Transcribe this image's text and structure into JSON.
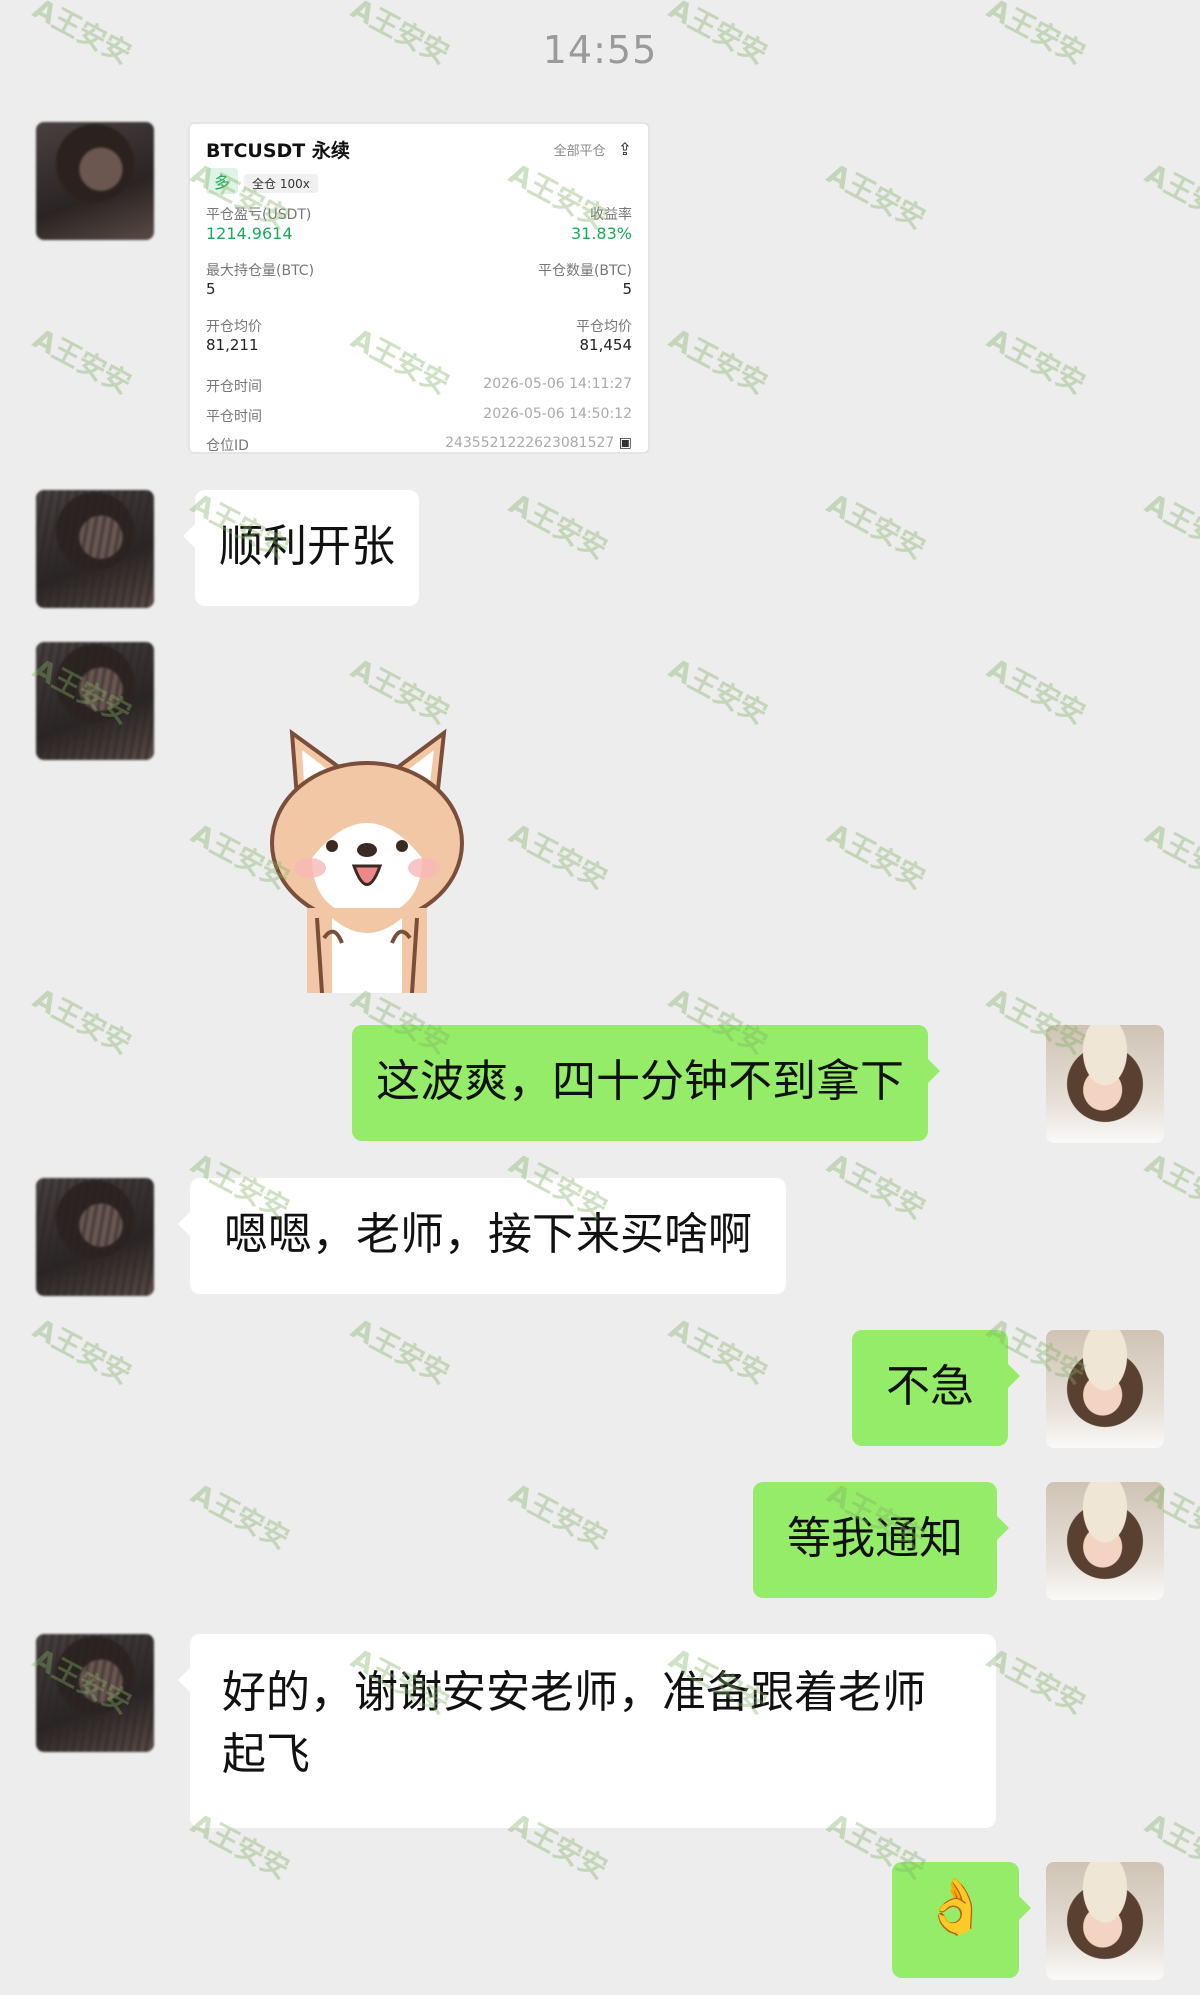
{
  "status": {
    "time": "14:55"
  },
  "trade_card": {
    "title": "BTCUSDT 永续",
    "tag_side": "多",
    "tag_margin": "全仓 100x",
    "action_label": "全部平仓",
    "pnl_label": "平仓盈亏(USDT)",
    "pnl_value": "1214.9614",
    "roi_label": "收益率",
    "roi_value": "31.83%",
    "max_pos_label": "最大持仓量(BTC)",
    "max_pos_value": "5",
    "close_qty_label": "平仓数量(BTC)",
    "close_qty_value": "5",
    "open_avg_label": "开仓均价",
    "open_avg_value": "81,211",
    "close_avg_label": "平仓均价",
    "close_avg_value": "81,454",
    "open_time_label": "开仓时间",
    "open_time_value": "2026-05-06 14:11:27",
    "close_time_label": "平仓时间",
    "close_time_value": "2026-05-06 14:50:12",
    "position_id_label": "仓位ID",
    "position_id_value": "2435521222623081527"
  },
  "messages": [
    {
      "side": "left",
      "text": "顺利开张"
    },
    {
      "side": "right",
      "text": "这波爽，四十分钟不到拿下"
    },
    {
      "side": "left",
      "text": "嗯嗯，老师，接下来买啥啊"
    },
    {
      "side": "right",
      "text": "不急"
    },
    {
      "side": "right",
      "text": "等我通知"
    },
    {
      "side": "left",
      "text": "好的，谢谢安安老师，准备跟着老师起飞"
    },
    {
      "side": "right",
      "text": "👌"
    }
  ],
  "watermark": "A王安安",
  "colors": {
    "bg": "#ededed",
    "right_bubble": "#95ec69",
    "left_bubble": "#ffffff",
    "profit": "#1aa85b"
  }
}
